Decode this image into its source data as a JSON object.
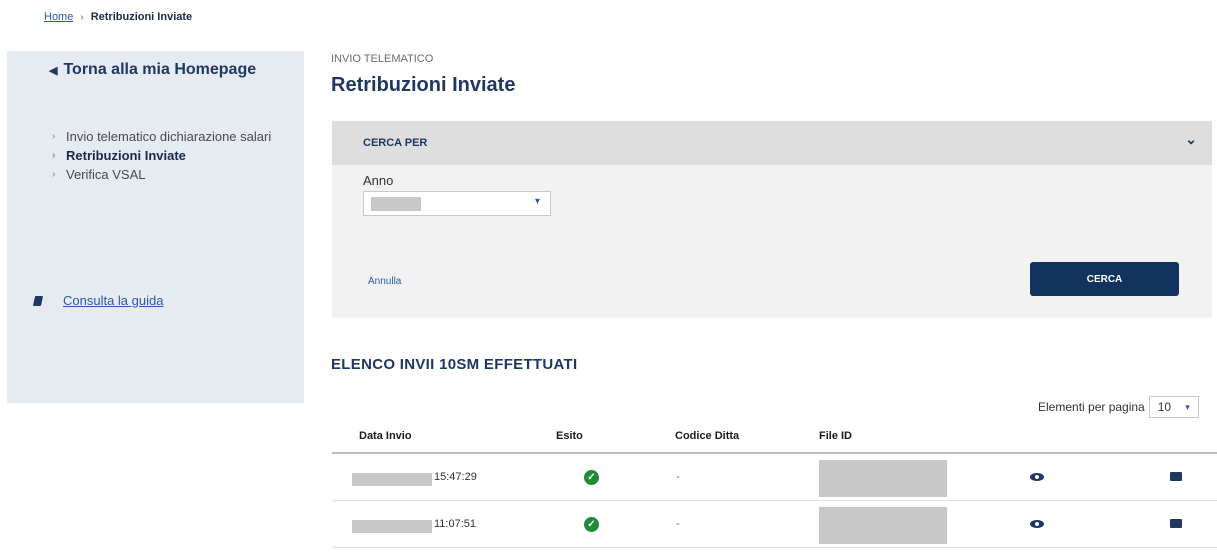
{
  "breadcrumb": {
    "home": "Home",
    "current": "Retribuzioni Inviate"
  },
  "sidebar": {
    "back_label": "Torna alla mia Homepage",
    "items": [
      {
        "label": "Invio telematico dichiarazione salari"
      },
      {
        "label": "Retribuzioni Inviate"
      },
      {
        "label": "Verifica VSAL"
      }
    ],
    "guide_label": "Consulta la guida"
  },
  "page": {
    "kicker": "INVIO TELEMATICO",
    "title": "Retribuzioni Inviate"
  },
  "search": {
    "header": "CERCA PER",
    "anno_label": "Anno",
    "cancel_label": "Annulla",
    "submit_label": "CERCA"
  },
  "list": {
    "title": "ELENCO INVII 10SM EFFETTUATI",
    "per_page_label": "Elementi per pagina",
    "per_page_value": "10",
    "columns": [
      "Data Invio",
      "Esito",
      "Codice Ditta",
      "File ID"
    ],
    "rows": [
      {
        "time": "15:47:29",
        "codice": "-"
      },
      {
        "time": "11:07:51",
        "codice": "-"
      }
    ]
  },
  "colors": {
    "primary": "#12335e",
    "sidebar_bg": "#e6ebf2",
    "success": "#1e8a3a",
    "link": "#2b5aa6"
  },
  "icons": [
    "chevron-right-icon",
    "caret-left-icon",
    "book-icon",
    "chevron-down-icon",
    "check-circle-icon",
    "eye-icon",
    "envelope-icon"
  ]
}
